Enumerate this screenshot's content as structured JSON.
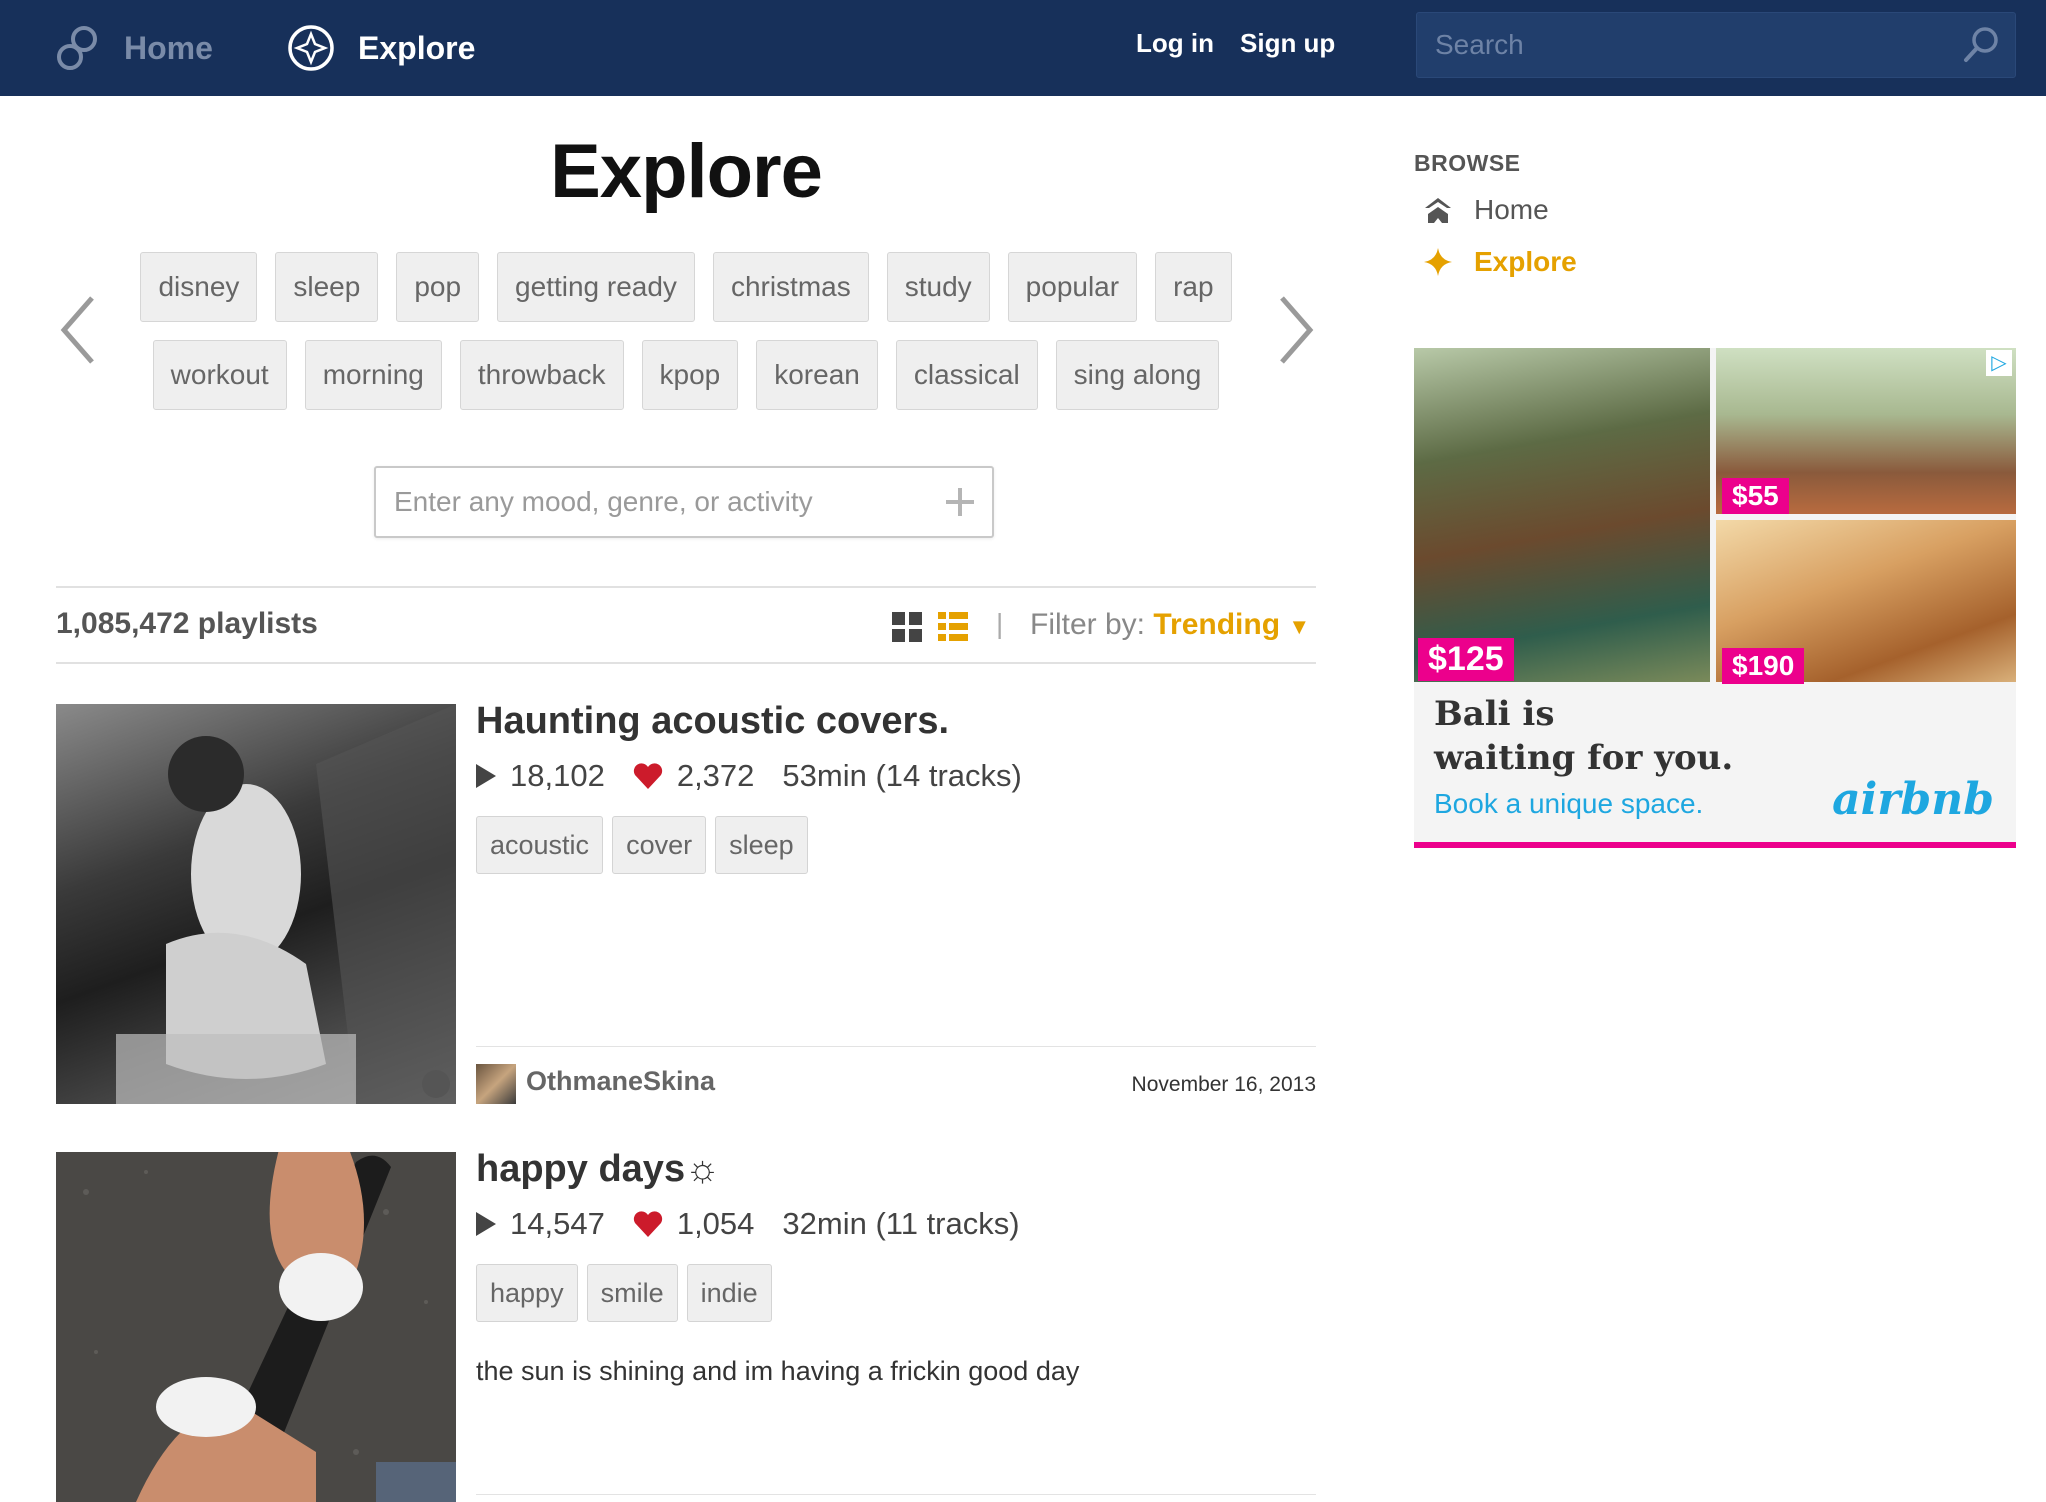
{
  "nav": {
    "home_label": "Home",
    "explore_label": "Explore",
    "login_label": "Log in",
    "signup_label": "Sign up",
    "search_placeholder": "Search"
  },
  "main": {
    "title": "Explore",
    "tag_rows": [
      [
        "disney",
        "sleep",
        "pop",
        "getting ready",
        "christmas",
        "study",
        "popular",
        "rap"
      ],
      [
        "workout",
        "morning",
        "throwback",
        "kpop",
        "korean",
        "classical",
        "sing along"
      ]
    ],
    "mood_placeholder": "Enter any mood, genre, or activity",
    "playlist_count": "1,085,472 playlists",
    "filter_label": "Filter by:",
    "filter_value": "Trending",
    "separator": "|"
  },
  "playlists": [
    {
      "title": "Haunting acoustic covers.",
      "plays": "18,102",
      "likes": "2,372",
      "duration": "53min (14 tracks)",
      "tags": [
        "acoustic",
        "cover",
        "sleep"
      ],
      "user": "OthmaneSkina",
      "date": "November 16, 2013"
    },
    {
      "title": "happy days☼",
      "plays": "14,547",
      "likes": "1,054",
      "duration": "32min (11 tracks)",
      "tags": [
        "happy",
        "smile",
        "indie"
      ],
      "description": "the sun is shining and im having a frickin good day"
    }
  ],
  "sidebar": {
    "heading": "BROWSE",
    "items": [
      {
        "label": "Home",
        "icon": "home-icon",
        "active": false
      },
      {
        "label": "Explore",
        "icon": "sparkle-icon",
        "active": true
      }
    ]
  },
  "ad": {
    "prices": [
      "$55",
      "$125",
      "$190"
    ],
    "headline_line1": "Bali is",
    "headline_line2": "waiting for you.",
    "subline": "Book a unique space.",
    "brand": "airbnb"
  },
  "colors": {
    "nav_bg": "#17305a",
    "accent": "#e5a100",
    "heart": "#cc1b2b",
    "ad_pink": "#ec008c",
    "ad_blue": "#1ea7e0"
  }
}
